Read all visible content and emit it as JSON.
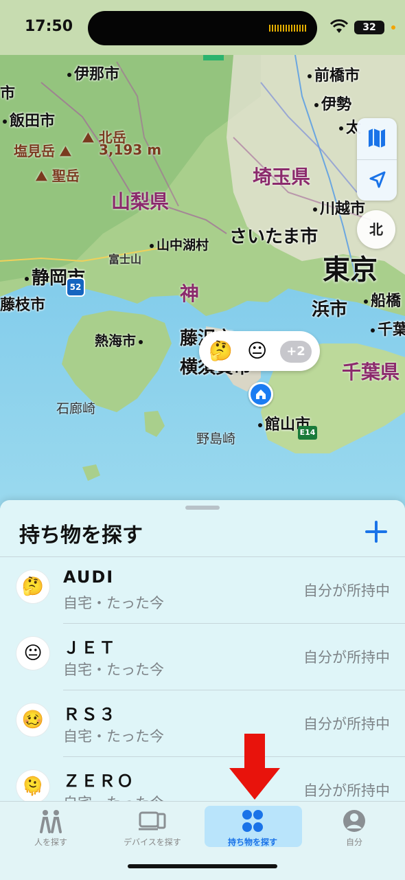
{
  "status": {
    "time": "17:50",
    "battery": "32"
  },
  "map": {
    "labels": {
      "ina": "伊那市",
      "maebashi": "前橋市",
      "iida": "飯田市",
      "isesaki": "伊勢",
      "ota": "太",
      "ichi_left": "市",
      "kitadake": "北岳",
      "kitadake_h": "3,193 m",
      "shiomidake": "塩見岳",
      "hijiridake": "聖岳",
      "saitama_pref": "埼玉県",
      "yamanashi_pref": "山梨県",
      "kawagoe": "川越市",
      "yamanakako": "山中湖村",
      "saitama_city": "さいたま市",
      "fujisan": "富士山",
      "tokyo": "東京",
      "shizuoka": "静岡市",
      "funabashi": "船橋",
      "fujieda": "藤枝市",
      "kana": "神",
      "hama": "浜市",
      "chiba": "千葉",
      "atami": "熱海市",
      "fujisawa": "藤沢市",
      "yokosuka": "横須賀市",
      "chiba_pref": "千葉県",
      "irozaki": "石廊崎",
      "tateyama": "館山市",
      "nojimazaki": "野島崎"
    },
    "route52": "52",
    "e14": "E14",
    "compass": "北",
    "pin": {
      "emoji1": "🤔",
      "emoji2": "😐",
      "more": "+2"
    }
  },
  "sheet": {
    "title": "持ち物を探す",
    "items": [
      {
        "emoji": "🤔",
        "name": "AUDI",
        "sub": "自宅・たった今",
        "status": "自分が所持中"
      },
      {
        "emoji": "😐",
        "name": "ＪＥＴ",
        "sub": "自宅・たった今",
        "status": "自分が所持中"
      },
      {
        "emoji": "🥴",
        "name": "ＲＳ３",
        "sub": "自宅・たった今",
        "status": "自分が所持中"
      },
      {
        "emoji": "🫠",
        "name": "ＺＥＲＯ",
        "sub": "自宅・たった今",
        "status": "自分が所持中"
      }
    ]
  },
  "tabs": [
    {
      "label": "人を探す",
      "icon": "people-icon"
    },
    {
      "label": "デバイスを探す",
      "icon": "devices-icon"
    },
    {
      "label": "持ち物を探す",
      "icon": "items-icon",
      "active": true
    },
    {
      "label": "自分",
      "icon": "me-icon"
    }
  ],
  "colors": {
    "accent": "#1a73e8",
    "arrow": "#e8130c"
  }
}
